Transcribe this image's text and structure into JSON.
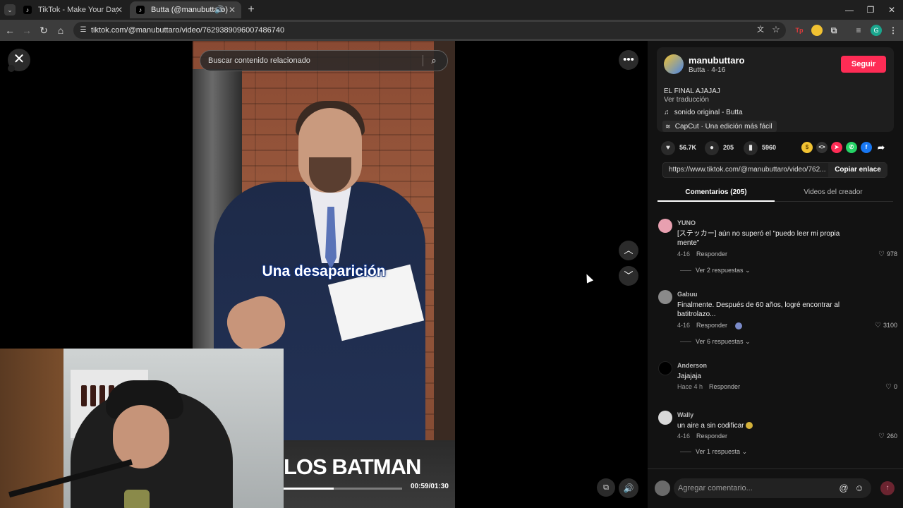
{
  "browser": {
    "tabs": [
      {
        "title": "TikTok - Make Your Day",
        "active": false
      },
      {
        "title": "Butta (@manubuttaro) | Tik",
        "active": true
      }
    ],
    "url": "tiktok.com/@manubuttaro/video/7629389096007486740",
    "extensions": [
      {
        "icon": "tp-extension-icon",
        "label": "Tp",
        "color": "#e03b3b"
      },
      {
        "icon": "extension-icon",
        "label": "",
        "color": "#f1c232"
      }
    ],
    "profile_initial": "G"
  },
  "video": {
    "search_placeholder": "Buscar contenido relacionado",
    "caption": "Una desaparición",
    "banner_text": "LOS BATMAN",
    "time": "00:59/01:30",
    "progress": 0.42
  },
  "post": {
    "username": "manubuttaro",
    "subline": "Butta · 4-16",
    "follow_label": "Seguir",
    "description": "EL FINAL AJAJAJ",
    "translate_label": "Ver traducción",
    "sound": "sonido original - Butta",
    "capcut": "CapCut · Una edición más fácil",
    "likes": "56.7K",
    "comments": "205",
    "saves": "5960",
    "share_link": "https://www.tiktok.com/@manubuttaro/video/762...",
    "copy_label": "Copiar enlace",
    "share_targets": [
      {
        "name": "coin",
        "color": "#f1c232"
      },
      {
        "name": "embed",
        "color": "#333333"
      },
      {
        "name": "send",
        "color": "#fe2c55"
      },
      {
        "name": "whatsapp",
        "color": "#25d366"
      },
      {
        "name": "facebook",
        "color": "#1877f2"
      },
      {
        "name": "share-arrow",
        "color": "#121212"
      }
    ]
  },
  "panel_tabs": [
    "Comentarios (205)",
    "Videos del creador"
  ],
  "comments": [
    {
      "name": "YUNO",
      "text": "[ステッカー] aún no superó el \"puedo leer mi propia mente\"",
      "date": "4-16",
      "reply": "Responder",
      "likes": "978",
      "more": "Ver 2 respuestas",
      "avatar_color": "#e8a0b0"
    },
    {
      "name": "Gabuu",
      "text": "Finalmente. Después de 60 años, logré encontrar al batitrolazo...",
      "date": "4-16",
      "reply": "Responder",
      "likes": "3100",
      "more": "Ver 6 respuestas",
      "avatar_color": "#8a8a8a"
    },
    {
      "name": "Anderson",
      "text": "Jajajaja",
      "date": "Hace 4 h",
      "reply": "Responder",
      "likes": "0",
      "more": "",
      "avatar_color": "#000000"
    },
    {
      "name": "Wally",
      "text": "un aire a sin codificar",
      "date": "4-16",
      "reply": "Responder",
      "likes": "260",
      "more": "Ver 1 respuesta",
      "avatar_color": "#d8d8d8"
    }
  ],
  "comment_input_placeholder": "Agregar comentario..."
}
